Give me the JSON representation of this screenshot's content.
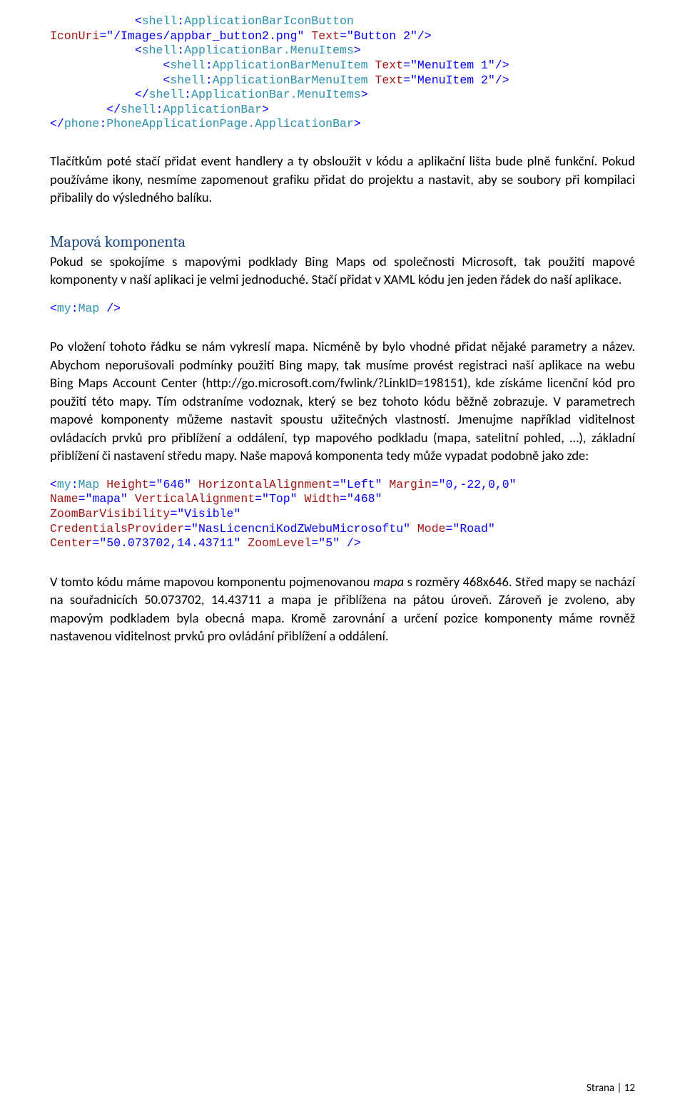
{
  "code1": {
    "l1a": "            <",
    "l1b": "shell",
    "l1c": ":",
    "l1d": "ApplicationBarIconButton",
    "l2a": "IconUri",
    "l2b": "=\"/Images/appbar_button2.png\"",
    "l2c": " Text",
    "l2d": "=\"Button 2\"/>",
    "l3a": "            <",
    "l3b": "shell",
    "l3c": ":",
    "l3d": "ApplicationBar.MenuItems",
    "l3e": ">",
    "l4a": "                <",
    "l4b": "shell",
    "l4c": ":",
    "l4d": "ApplicationBarMenuItem",
    "l4e": " Text",
    "l4f": "=\"MenuItem 1\"/>",
    "l5a": "                <",
    "l5b": "shell",
    "l5c": ":",
    "l5d": "ApplicationBarMenuItem",
    "l5e": " Text",
    "l5f": "=\"MenuItem 2\"/>",
    "l6a": "            </",
    "l6b": "shell",
    "l6c": ":",
    "l6d": "ApplicationBar.MenuItems",
    "l6e": ">",
    "l7a": "        </",
    "l7b": "shell",
    "l7c": ":",
    "l7d": "ApplicationBar",
    "l7e": ">",
    "l8a": "</",
    "l8b": "phone",
    "l8c": ":",
    "l8d": "PhoneApplicationPage.ApplicationBar",
    "l8e": ">"
  },
  "para1": "Tlačítkům poté stačí přidat event handlery a ty obsloužit v kódu a aplikační lišta bude plně funkční. Pokud používáme ikony, nesmíme zapomenout grafiku přidat do projektu a nastavit, aby se soubory při kompilaci přibalily do výsledného balíku.",
  "heading1": "Mapová komponenta",
  "para2": "Pokud se spokojíme s mapovými podklady Bing Maps od společnosti Microsoft, tak použití mapové komponenty v naší aplikaci je velmi jednoduché. Stačí přidat v XAML kódu jen jeden řádek do naší aplikace.",
  "code2": {
    "a": "<",
    "b": "my",
    "c": ":",
    "d": "Map",
    "e": " />"
  },
  "para3": "Po vložení tohoto řádku se nám vykreslí mapa. Nicméně by bylo vhodné přidat nějaké parametry a název. Abychom neporušovali podmínky použití Bing mapy, tak musíme provést registraci naší aplikace na webu Bing Maps Account Center (http://go.microsoft.com/fwlink/?LinkID=198151), kde získáme licenční kód pro použití této mapy. Tím odstraníme vodoznak, který se bez tohoto kódu běžně zobrazuje. V parametrech mapové komponenty můžeme nastavit spoustu užitečných vlastností. Jmenujme například viditelnost ovládacích prvků pro přiblížení a oddálení, typ mapového podkladu (mapa, satelitní pohled, …), základní přiblížení či nastavení středu mapy. Naše mapová komponenta tedy může vypadat podobně jako zde:",
  "code3": {
    "l1a": "<",
    "l1b": "my",
    "l1c": ":",
    "l1d": "Map",
    "l1e": " Height",
    "l1f": "=\"646\"",
    "l1g": " HorizontalAlignment",
    "l1h": "=\"Left\"",
    "l1i": " Margin",
    "l1j": "=\"0,-22,0,0\"",
    "l2a": "Name",
    "l2b": "=\"mapa\"",
    "l2c": " VerticalAlignment",
    "l2d": "=\"Top\"",
    "l2e": " Width",
    "l2f": "=\"468\"",
    "l3a": "ZoomBarVisibility",
    "l3b": "=\"Visible\"",
    "l4a": "CredentialsProvider",
    "l4b": "=\"NasLicencniKodZWebuMicrosoftu\"",
    "l4c": " Mode",
    "l4d": "=\"Road\"",
    "l5a": "Center",
    "l5b": "=\"50.073702,14.43711\"",
    "l5c": " ZoomLevel",
    "l5d": "=\"5\" />"
  },
  "para4_a": "V tomto kódu máme mapovou komponentu pojmenovanou ",
  "para4_b": "mapa",
  "para4_c": " s rozměry 468x646. Střed mapy se nachází na souřadnicích 50.073702, 14.43711 a mapa je přiblížena na pátou úroveň. Zároveň je zvoleno, aby mapovým podkladem byla obecná mapa. Kromě zarovnání a určení pozice komponenty máme rovněž nastavenou viditelnost prvků pro ovládání přiblížení a oddálení.",
  "footer": "Strana | 12"
}
